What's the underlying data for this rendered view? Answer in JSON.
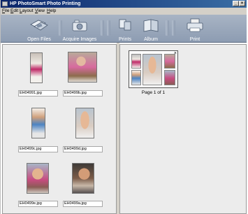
{
  "window": {
    "title": "HP PhotoSmart Photo Printing"
  },
  "menu": [
    "File",
    "Edit",
    "Layout",
    "View",
    "Help"
  ],
  "toolbar": {
    "open_files": "Open Files",
    "acquire_images": "Acquire Images",
    "prints": "Prints",
    "album": "Album",
    "print": "Print"
  },
  "thumbnails": [
    {
      "filename": "EH04991.jpg"
    },
    {
      "filename": "EH0499b.jpg"
    },
    {
      "filename": "EH0499c.jpg"
    },
    {
      "filename": "EH0499d.jpg"
    },
    {
      "filename": "EH0499e.jpg"
    },
    {
      "filename": "EH0499a.jpg"
    }
  ],
  "layout_preview": {
    "page_label": "Page 1 of 1",
    "close_glyph": "×"
  },
  "colors": {
    "titlebar": "#0a246a",
    "toolbar": "#9aa8bc",
    "pane": "#ececec"
  }
}
